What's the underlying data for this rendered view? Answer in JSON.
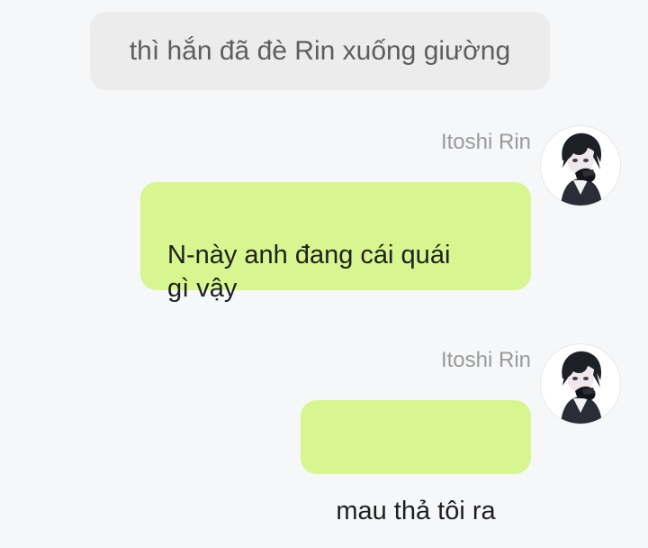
{
  "narration": {
    "text": "thì hắn đã đè Rin xuống giường"
  },
  "messages": [
    {
      "sender": "Itoshi Rin",
      "avatar_icon": "character-avatar-icon",
      "text": "N-này anh đang cái quái\ngì vậy"
    },
    {
      "sender": "Itoshi Rin",
      "avatar_icon": "character-avatar-icon",
      "text": "mau thả tôi ra"
    }
  ],
  "colors": {
    "background": "#f6f7f9",
    "narration_bubble": "#ececed",
    "outgoing_bubble": "#d7f68f",
    "sender_name": "#9a9a9a"
  }
}
